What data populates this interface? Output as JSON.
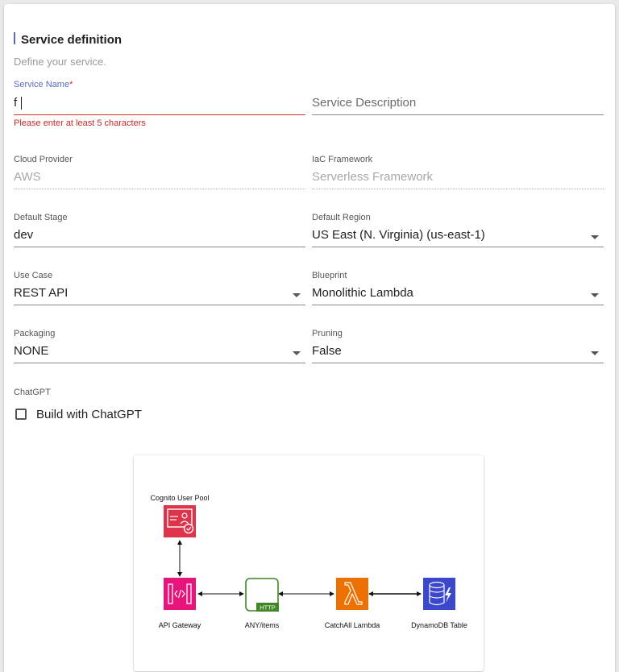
{
  "section": {
    "title": "Service definition",
    "subtitle": "Define your service."
  },
  "fields": {
    "service_name": {
      "label": "Service Name",
      "required_mark": "*",
      "value": "f",
      "error": "Please enter at least 5 characters"
    },
    "service_description": {
      "placeholder": "Service Description"
    },
    "cloud_provider": {
      "label": "Cloud Provider",
      "value": "AWS"
    },
    "iac_framework": {
      "label": "IaC Framework",
      "value": "Serverless Framework"
    },
    "default_stage": {
      "label": "Default Stage",
      "value": "dev"
    },
    "default_region": {
      "label": "Default Region",
      "value": "US East (N. Virginia) (us-east-1)"
    },
    "use_case": {
      "label": "Use Case",
      "value": "REST API"
    },
    "blueprint": {
      "label": "Blueprint",
      "value": "Monolithic Lambda"
    },
    "packaging": {
      "label": "Packaging",
      "value": "NONE"
    },
    "pruning": {
      "label": "Pruning",
      "value": "False"
    },
    "chatgpt": {
      "label": "ChatGPT",
      "checkbox_label": "Build with ChatGPT",
      "checked": false
    }
  },
  "diagram": {
    "nodes": {
      "cognito": {
        "label": "Cognito User Pool",
        "icon": "cognito-icon",
        "color": "#dd344c"
      },
      "api_gateway": {
        "label": "API Gateway",
        "icon": "api-gateway-icon",
        "color": "#e7157b"
      },
      "any_items": {
        "label": "ANY/items",
        "icon": "http-endpoint-icon",
        "color": "#3f8624",
        "badge": "HTTP"
      },
      "lambda": {
        "label": "CatchAll Lambda",
        "icon": "lambda-icon",
        "color": "#ed7100"
      },
      "dynamodb": {
        "label": "DynamoDB Table",
        "icon": "dynamodb-icon",
        "color": "#3b48cc"
      }
    }
  },
  "colors": {
    "accent": "#5b6bc0",
    "error": "#d32f2f"
  }
}
